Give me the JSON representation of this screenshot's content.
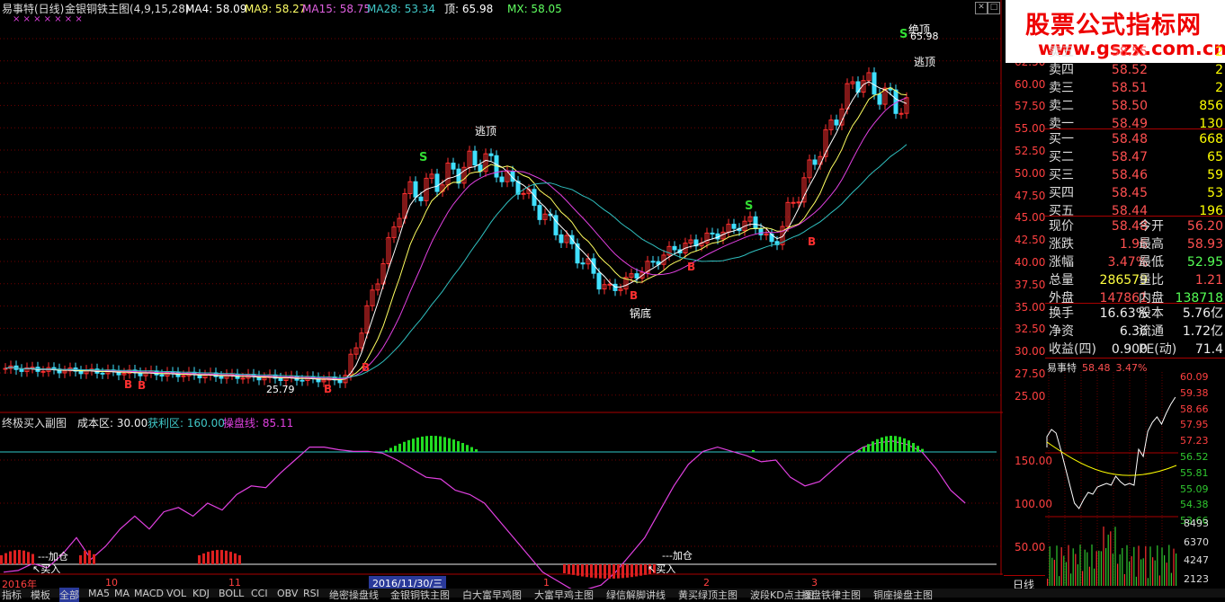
{
  "header": {
    "stock": "易事特(日线)",
    "indicator": "金银铜铁主图",
    "params": "(4,9,15,28)",
    "ma4": "MA4: 58.09",
    "ma9": "MA9: 58.27",
    "ma15": "MA15: 58.75",
    "ma28": "MA28: 53.34",
    "top": "顶: 65.98",
    "mx": "MX: 58.05",
    "markers": "×  ×  ×  ×  ×  ×  ×"
  },
  "colors": {
    "ma4": "#ffffff",
    "ma9": "#ffff60",
    "ma15": "#e040e0",
    "ma28": "#30c0c0",
    "up": "#ff3030",
    "down": "#40e0ff",
    "grid": "#700000",
    "accent": "#ff0000"
  },
  "annotations": {
    "s1": "S",
    "s2": "S",
    "s3": "S",
    "escape1": "逃顶",
    "escape2": "逃顶",
    "top": "绝顶",
    "top_price": "65.98",
    "bottom": "锅底",
    "low_price": "25.79",
    "b1": "B",
    "b2": "B",
    "b3": "B",
    "b4": "B",
    "b5": "B",
    "b6": "B",
    "b7": "B"
  },
  "main_axis": {
    "ticks": [
      "6",
      "62.50",
      "60.00",
      "57.50",
      "55.00",
      "52.50",
      "50.00",
      "47.50",
      "45.00",
      "42.50",
      "40.00",
      "37.50",
      "35.00",
      "32.50",
      "30.00",
      "27.50",
      "25.00"
    ]
  },
  "sub_header": {
    "title": "终极买入副图",
    "cost": "成本区: 30.00",
    "profit": "获利区: 160.00",
    "control": "操盘线: 85.11"
  },
  "sub_axis": {
    "ticks": [
      "150.00",
      "100.00",
      "50.00"
    ]
  },
  "sub_labels": {
    "add1": "---加仓",
    "buy1": "↖买入",
    "add2": "---加仓",
    "buy2": "↖买入"
  },
  "time_axis": {
    "labels": [
      "2016年",
      "10",
      "11",
      "2016/11/30/三",
      "1",
      "2",
      "3"
    ]
  },
  "quotes": {
    "sell": [
      {
        "label": "卖五",
        "price": "58.55",
        "vol": "2"
      },
      {
        "label": "卖四",
        "price": "58.52",
        "vol": "2"
      },
      {
        "label": "卖三",
        "price": "58.51",
        "vol": "2"
      },
      {
        "label": "卖二",
        "price": "58.50",
        "vol": "856"
      },
      {
        "label": "卖一",
        "price": "58.49",
        "vol": "130"
      }
    ],
    "buy": [
      {
        "label": "买一",
        "price": "58.48",
        "vol": "668"
      },
      {
        "label": "买二",
        "price": "58.47",
        "vol": "65"
      },
      {
        "label": "买三",
        "price": "58.46",
        "vol": "59"
      },
      {
        "label": "买四",
        "price": "58.45",
        "vol": "53"
      },
      {
        "label": "买五",
        "price": "58.44",
        "vol": "196"
      }
    ],
    "stats": [
      {
        "l1": "现价",
        "v1": "58.48",
        "l2": "今开",
        "v2": "56.20"
      },
      {
        "l1": "涨跌",
        "v1": "1.96",
        "l2": "最高",
        "v2": "58.93"
      },
      {
        "l1": "涨幅",
        "v1": "3.47%",
        "l2": "最低",
        "v2": "52.95"
      },
      {
        "l1": "总量",
        "v1": "286579",
        "l2": "量比",
        "v2": "1.21"
      },
      {
        "l1": "外盘",
        "v1": "147861",
        "l2": "内盘",
        "v2": "138718"
      }
    ],
    "info": [
      {
        "l1": "换手",
        "v1": "16.63%",
        "l2": "股本",
        "v2": "5.76亿"
      },
      {
        "l1": "净资",
        "v1": "6.36",
        "l2": "流通",
        "v2": "1.72亿"
      },
      {
        "l1": "收益(四)",
        "v1": "0.900",
        "l2": "PE(动)",
        "v2": "71.4"
      }
    ]
  },
  "mini": {
    "name": "易事特",
    "price": "58.48",
    "pct": "3.47%",
    "ticks": [
      "60.09",
      "59.38",
      "58.66",
      "57.95",
      "57.23",
      "56.52",
      "55.81",
      "55.09",
      "54.38",
      "53.66"
    ],
    "vol_ticks": [
      "8493",
      "6370",
      "4247",
      "2123"
    ],
    "period": "日线"
  },
  "brand": {
    "name": "股票公式指标网",
    "url": "www.gszx.com.cn"
  },
  "tabs": [
    "指标",
    "模板",
    "全部",
    "MA5",
    "MA",
    "MACD",
    "VOL",
    "KDJ",
    "BOLL",
    "CCI",
    "OBV",
    "RSI",
    "绝密操盘线",
    "金银铜铁主图",
    "白大富早鸡图",
    "大富早鸡主图",
    "绿信解脚讲线",
    "黄买绿顶主图",
    "波段KD点主图",
    "操盘铁律主图",
    "铜座操盘主图"
  ]
}
